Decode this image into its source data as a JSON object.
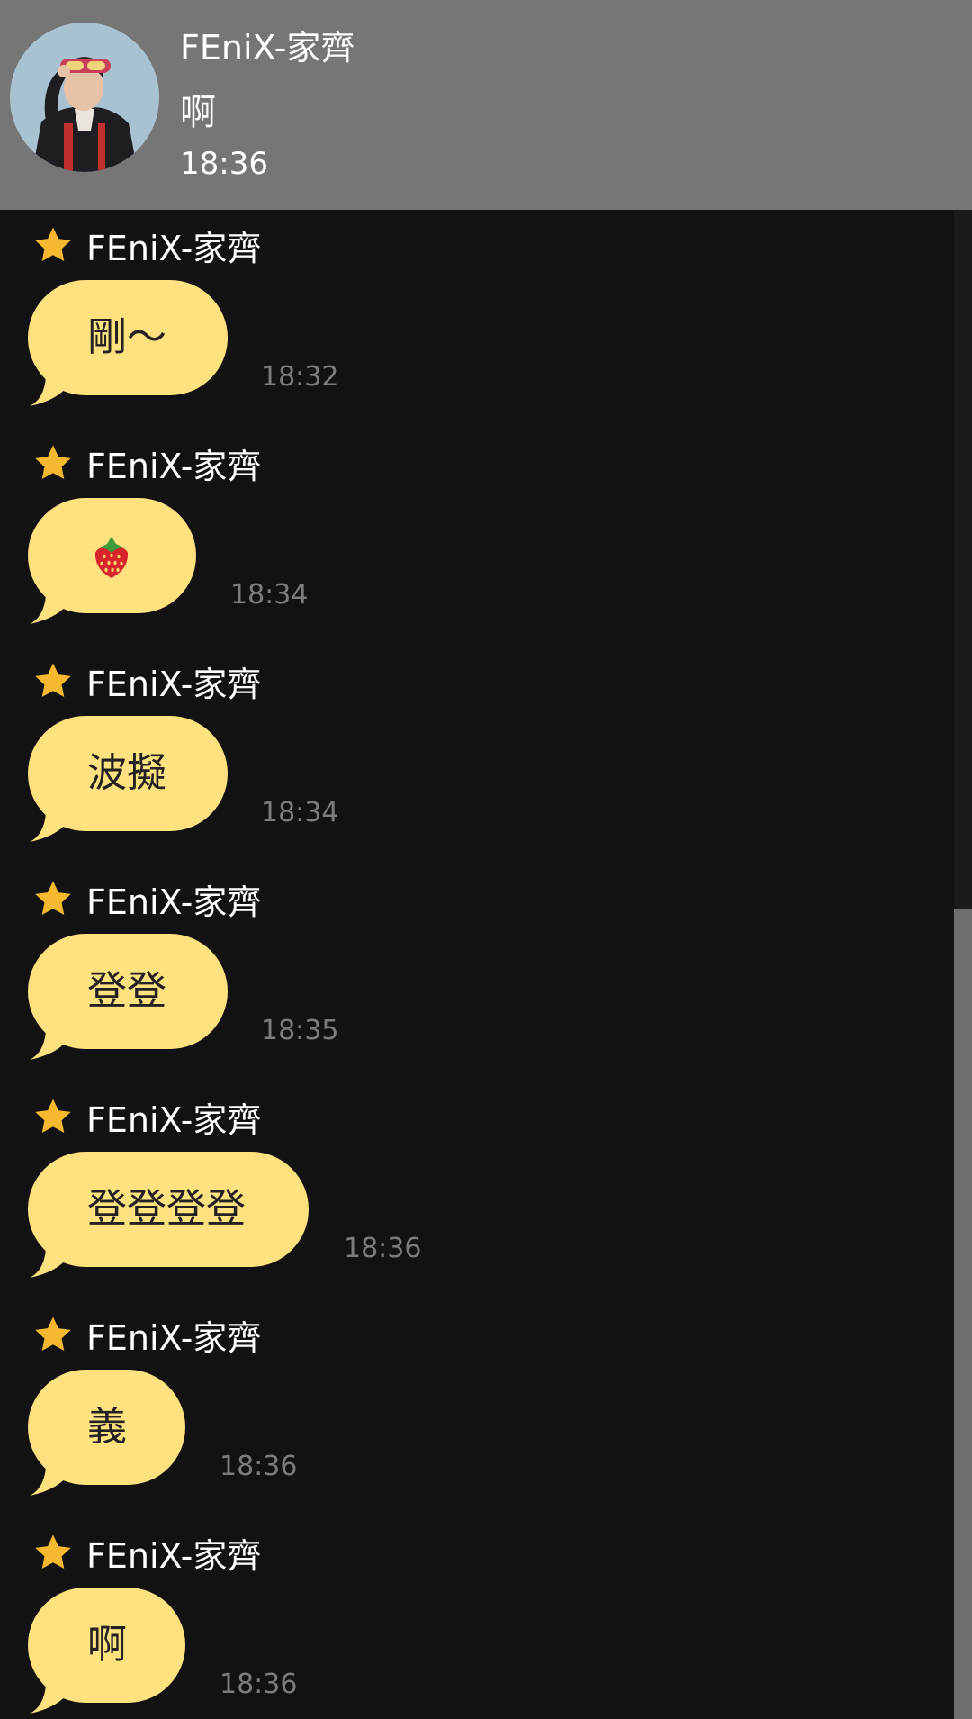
{
  "header": {
    "name": "FEniX-家齊",
    "last_message": "啊",
    "time": "18:36",
    "avatar_icon": "profile-photo"
  },
  "colors": {
    "bubble": "#ffe17f",
    "star": "#f5b82e",
    "header_bg": "#767676",
    "background": "#121212"
  },
  "messages": [
    {
      "sender": "FEniX-家齊",
      "text": "剛～",
      "time": "18:32"
    },
    {
      "sender": "FEniX-家齊",
      "text": "",
      "icon": "strawberry-emoji",
      "time": "18:34"
    },
    {
      "sender": "FEniX-家齊",
      "text": "波擬",
      "time": "18:34"
    },
    {
      "sender": "FEniX-家齊",
      "text": "登登",
      "time": "18:35"
    },
    {
      "sender": "FEniX-家齊",
      "text": "登登登登",
      "time": "18:36"
    },
    {
      "sender": "FEniX-家齊",
      "text": "義",
      "time": "18:36"
    },
    {
      "sender": "FEniX-家齊",
      "text": "啊",
      "time": "18:36"
    }
  ]
}
